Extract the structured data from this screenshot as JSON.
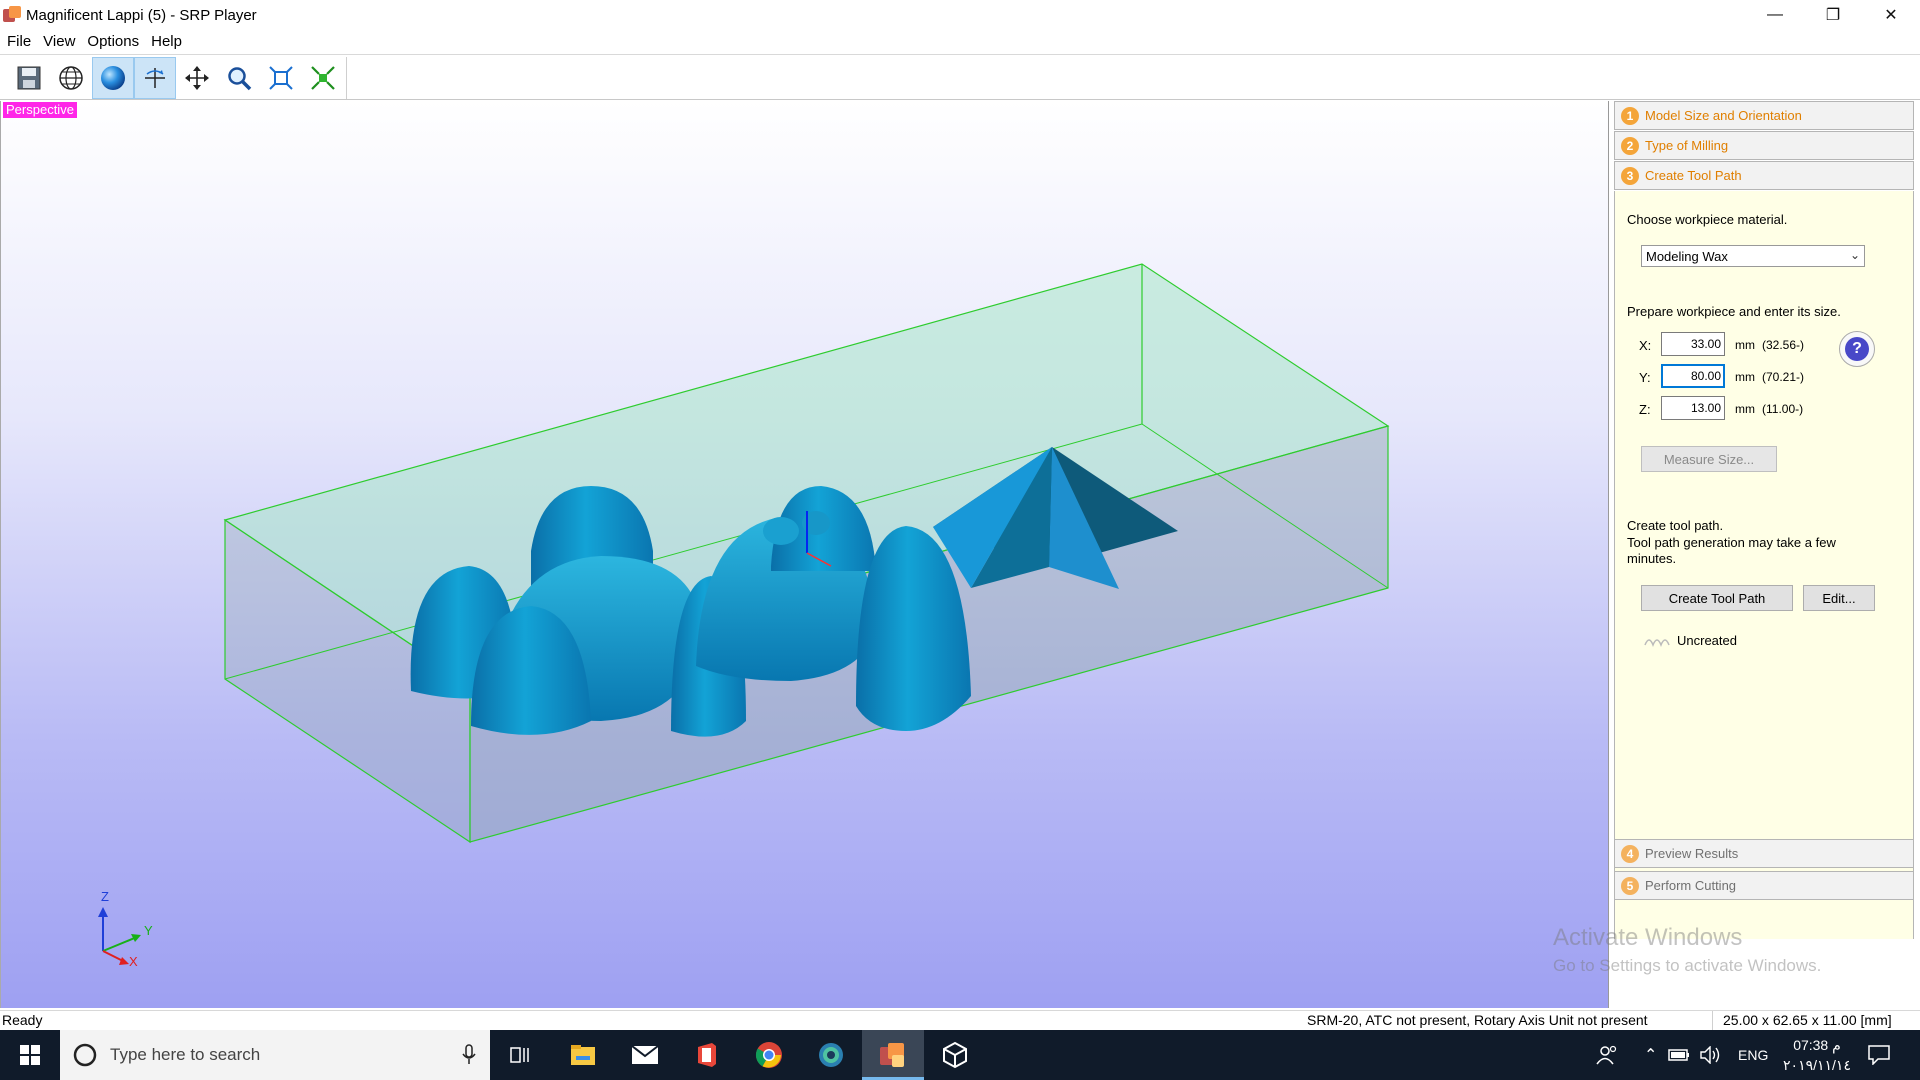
{
  "window": {
    "title": "Magnificent Lappi (5) - SRP Player",
    "app_icon": "srp-player-icon",
    "controls": {
      "minimize": "—",
      "restore": "❐",
      "close": "✕"
    }
  },
  "menu": [
    "File",
    "View",
    "Options",
    "Help"
  ],
  "toolbar": {
    "buttons": [
      {
        "name": "save-icon",
        "active": false
      },
      {
        "name": "wireframe-globe-icon",
        "active": false
      },
      {
        "name": "shaded-sphere-icon",
        "active": true
      },
      {
        "name": "rotate-icon",
        "active": true
      },
      {
        "name": "pan-icon",
        "active": false
      },
      {
        "name": "zoom-icon",
        "active": false
      },
      {
        "name": "fit-view-icon",
        "active": false
      },
      {
        "name": "zoom-selection-icon",
        "active": false
      }
    ]
  },
  "viewport": {
    "label": "Perspective",
    "axes": {
      "z": "Z",
      "y": "Y",
      "x": "X"
    },
    "colors": {
      "bounding_box": "#2ecc2e",
      "model": "#0a8fc4",
      "label_bg": "#ff26e8"
    }
  },
  "panel": {
    "steps": [
      {
        "num": "1",
        "label": "Model Size and Orientation"
      },
      {
        "num": "2",
        "label": "Type of Milling"
      },
      {
        "num": "3",
        "label": "Create Tool Path"
      },
      {
        "num": "4",
        "label": "Preview Results"
      },
      {
        "num": "5",
        "label": "Perform Cutting"
      }
    ],
    "material_prompt": "Choose workpiece material.",
    "material_value": "Modeling Wax",
    "size_prompt": "Prepare workpiece and enter its size.",
    "size": {
      "x": {
        "label": "X:",
        "value": "33.00",
        "unit": "mm",
        "range": "(32.56-)"
      },
      "y": {
        "label": "Y:",
        "value": "80.00",
        "unit": "mm",
        "range": "(70.21-)"
      },
      "z": {
        "label": "Z:",
        "value": "13.00",
        "unit": "mm",
        "range": "(11.00-)"
      }
    },
    "help_label": "?",
    "measure_button": "Measure Size...",
    "toolpath_prompt": "Create tool path.",
    "toolpath_note": "Tool path generation may take a few minutes.",
    "create_button": "Create Tool Path",
    "edit_button": "Edit...",
    "status": "Uncreated"
  },
  "watermark": {
    "line1": "Activate Windows",
    "line2": "Go to Settings to activate Windows."
  },
  "statusbar": {
    "ready": "Ready",
    "device": "SRM-20, ATC not present, Rotary Axis Unit not present",
    "model_size": "25.00 x  62.65 x  11.00 [mm]"
  },
  "taskbar": {
    "search_placeholder": "Type here to search",
    "apps": [
      "task-view-icon",
      "file-explorer-icon",
      "mail-icon",
      "office-icon",
      "chrome-icon",
      "camera-app-icon",
      "srp-player-icon",
      "3d-viewer-icon"
    ],
    "language": "ENG",
    "time": "07:38 م",
    "date": "٢٠١٩/١١/١٤"
  }
}
